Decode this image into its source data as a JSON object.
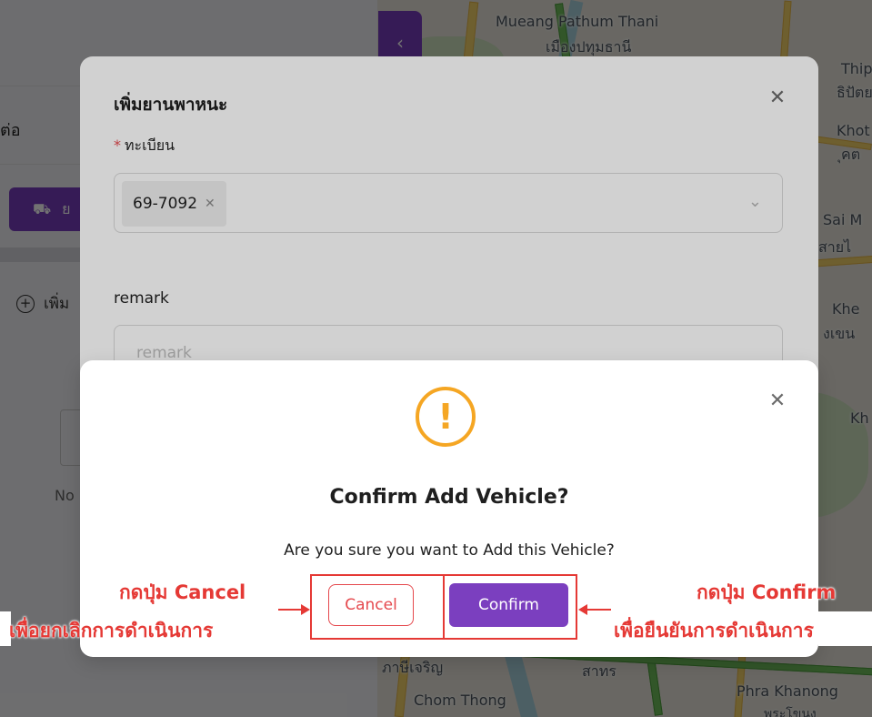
{
  "map": {
    "labels": [
      "Mueang Pathum Thani",
      "เมืองปทุมธานี",
      "Thipa",
      "ธิปัตย",
      "Khot",
      "ุคต",
      "Sai M",
      "สายไ",
      "Khe",
      "งเขน",
      "Kh",
      "ภาษีเจริญ",
      "สาทร",
      "Chom Thong",
      "Phra Khanong",
      "พระโขนง"
    ]
  },
  "left_page": {
    "heading_partial": "ต่อ",
    "vehicle_button_partial": "ย",
    "add_partial": "เพิ่ม",
    "nodata_partial": "No"
  },
  "add_vehicle_modal": {
    "title": "เพิ่มยานพาหนะ",
    "plate_label": "ทะเบียน",
    "required_mark": "*",
    "selected_tags": [
      "69-7092"
    ],
    "remark_label": "remark",
    "remark_placeholder": "remark"
  },
  "confirm_modal": {
    "icon": "exclamation-circle-icon",
    "title": "Confirm Add Vehicle?",
    "message": "Are you sure you want to Add this Vehicle?",
    "cancel_label": "Cancel",
    "confirm_label": "Confirm"
  },
  "annotations": {
    "cancel_line1": "กดปุ่ม Cancel",
    "cancel_line2": "เพื่อยกเลิกการดำเนินการ",
    "confirm_line1": "กดปุ่ม Confirm",
    "confirm_line2": "เพื่อยืนยันการดำเนินการ",
    "highlight_color": "#e53935"
  },
  "colors": {
    "primary": "#7b3fbf",
    "danger": "#e5484d",
    "warning": "#f5a623"
  }
}
